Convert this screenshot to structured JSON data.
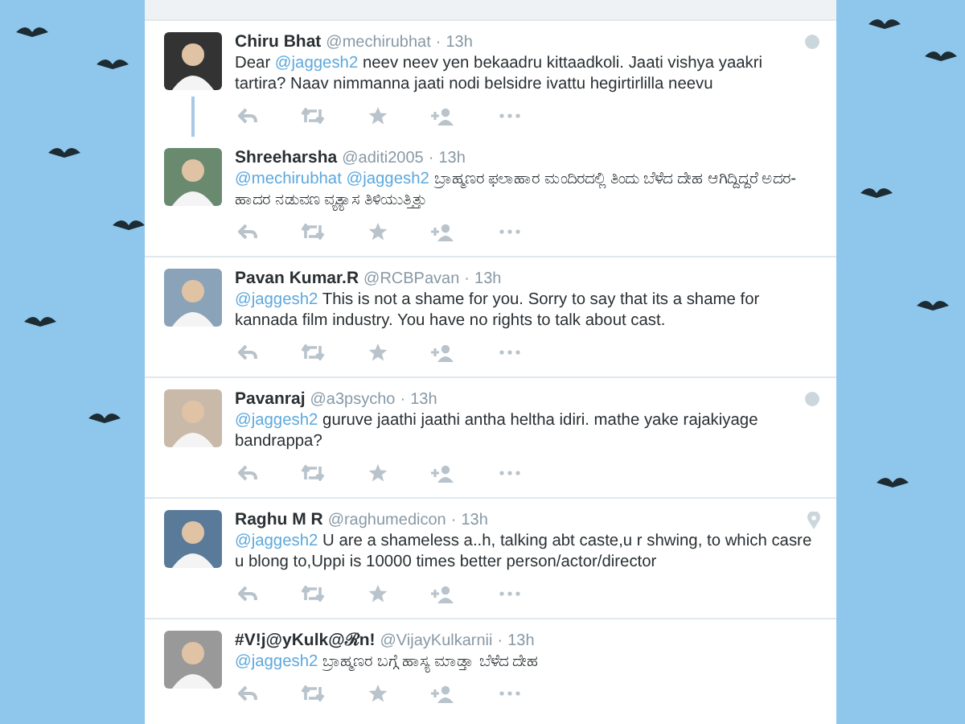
{
  "tweets": [
    {
      "name": "Chiru Bhat",
      "handle": "@mechirubhat",
      "separator": "·",
      "time": "13h",
      "connected_below": true,
      "corner_icon": {
        "kind": "circle"
      },
      "parts": [
        {
          "kind": "text",
          "text": "Dear "
        },
        {
          "kind": "mention",
          "text": "@jaggesh2"
        },
        {
          "kind": "text",
          "text": " neev neev yen bekaadru kittaadkoli. Jaati vishya yaakri tartira? Naav nimmanna jaati nodi belsidre ivattu hegirtirlilla neevu"
        }
      ]
    },
    {
      "name": "Shreeharsha",
      "handle": "@aditi2005",
      "separator": "·",
      "time": "13h",
      "connected_below": false,
      "parts": [
        {
          "kind": "mention",
          "text": "@mechirubhat @jaggesh2"
        },
        {
          "kind": "text",
          "text": " ಬ್ರಾಹ್ಮಣರ ಫಲಾಹಾರ ಮಂದಿರದಲ್ಲಿ ತಿಂದು ಬೆಳೆದ ದೇಹ ಆಗಿದ್ದಿದ್ದರೆ ಅದರ-ಹಾದರ ನಡುವಣ ವ್ಯತ್ಯಾಸ ತಿಳಿಯುತ್ತಿತ್ತು"
        }
      ]
    },
    {
      "name": "Pavan Kumar.R",
      "handle": "@RCBPavan",
      "separator": "·",
      "time": "13h",
      "connected_below": false,
      "parts": [
        {
          "kind": "mention",
          "text": "@jaggesh2"
        },
        {
          "kind": "text",
          "text": " This is not a shame for you. Sorry to say that its a shame for kannada film industry. You have no rights to talk about cast."
        }
      ]
    },
    {
      "name": "Pavanraj",
      "handle": "@a3psycho",
      "separator": "·",
      "time": "13h",
      "connected_below": false,
      "corner_icon": {
        "kind": "circle"
      },
      "parts": [
        {
          "kind": "mention",
          "text": "@jaggesh2"
        },
        {
          "kind": "text",
          "text": " guruve jaathi jaathi antha heltha idiri. mathe yake rajakiyage bandrappa?"
        }
      ]
    },
    {
      "name": "Raghu M R",
      "handle": "@raghumedicon",
      "separator": "·",
      "time": "13h",
      "connected_below": false,
      "corner_icon": {
        "kind": "pin"
      },
      "parts": [
        {
          "kind": "mention",
          "text": "@jaggesh2"
        },
        {
          "kind": "text",
          "text": " U are a shameless a..h, talking abt caste,u r shwing, to which casre u blong to,Uppi is 10000 times better person/actor/director"
        }
      ]
    },
    {
      "name": "#V!j@yKulk@ℛn!",
      "handle": "@VijayKulkarnii",
      "separator": "·",
      "time": "13h",
      "connected_below": false,
      "parts": [
        {
          "kind": "mention",
          "text": "@jaggesh2"
        },
        {
          "kind": "text",
          "text": " ಬ್ರಾಹ್ಮಣರ ಬಗ್ಗೆ ಹಾಸ್ಯ ಮಾಡ್ತಾ ಬೆಳೆದ ದೇಹ"
        }
      ]
    }
  ]
}
